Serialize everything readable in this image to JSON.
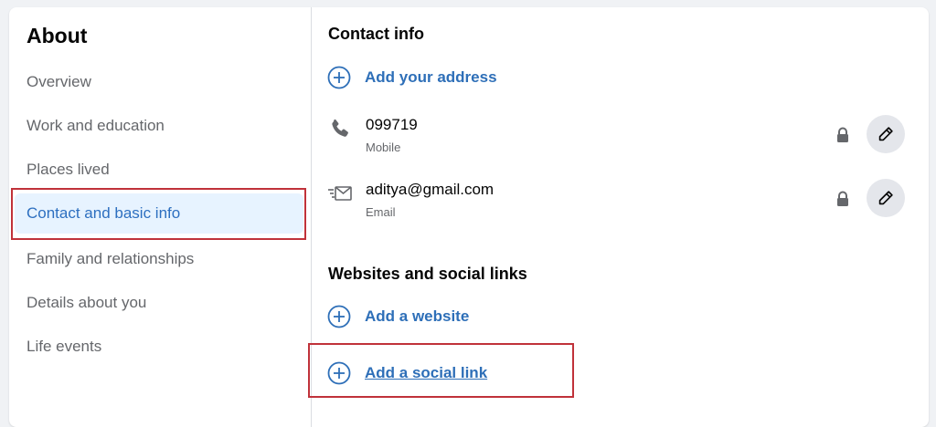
{
  "sidebar": {
    "title": "About",
    "items": [
      {
        "label": "Overview"
      },
      {
        "label": "Work and education"
      },
      {
        "label": "Places lived"
      },
      {
        "label": "Contact and basic info"
      },
      {
        "label": "Family and relationships"
      },
      {
        "label": "Details about you"
      },
      {
        "label": "Life events"
      }
    ]
  },
  "contact": {
    "title": "Contact info",
    "add_address": "Add your address",
    "phone": {
      "value": "099719",
      "type": "Mobile"
    },
    "email": {
      "value": "aditya@gmail.com",
      "type": "Email"
    }
  },
  "websites": {
    "title": "Websites and social links",
    "add_website": "Add a website",
    "add_social": "Add a social link"
  },
  "colors": {
    "accent": "#2e6fb8",
    "active_bg": "#e7f3ff",
    "highlight": "#c0323a"
  },
  "icons": {
    "add": "plus-circle-icon",
    "phone": "phone-icon",
    "email": "email-icon",
    "privacy": "lock-icon",
    "edit": "pencil-icon"
  }
}
